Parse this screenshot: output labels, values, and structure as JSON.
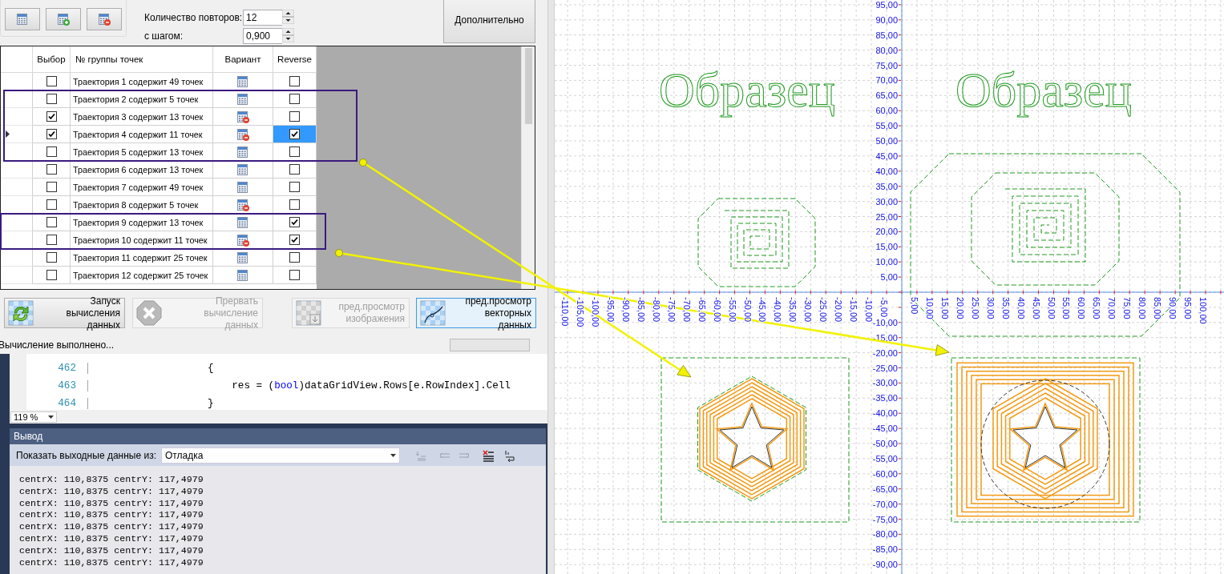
{
  "trajectory_group": {
    "buttons": [
      {
        "kind": "plain"
      },
      {
        "kind": "add"
      },
      {
        "kind": "remove"
      }
    ]
  },
  "params": [
    {
      "label": "Количество повторов:",
      "value": "12"
    },
    {
      "label": "с шагом:",
      "value": "0,900"
    }
  ],
  "more_button": "Дополнительно",
  "grid": {
    "columns": [
      "Выбор",
      "№ группы точек",
      "Вариант",
      "Reverse"
    ],
    "rows": [
      {
        "current": false,
        "choice": false,
        "name": "Траектория 1 содержит 49 точек",
        "kind": "plain",
        "reverse": false,
        "reverse_selected": false
      },
      {
        "current": false,
        "choice": false,
        "name": "Траектория 2 содержит 5 точек",
        "kind": "plain",
        "reverse": false,
        "reverse_selected": false
      },
      {
        "current": false,
        "choice": true,
        "name": "Траектория 3 содержит 13 точек",
        "kind": "remove",
        "reverse": false,
        "reverse_selected": false
      },
      {
        "current": true,
        "choice": true,
        "name": "Траектория 4 содержит 11 точек",
        "kind": "remove",
        "reverse": true,
        "reverse_selected": true
      },
      {
        "current": false,
        "choice": false,
        "name": "Траектория 5 содержит 13 точек",
        "kind": "plain",
        "reverse": false,
        "reverse_selected": false
      },
      {
        "current": false,
        "choice": false,
        "name": "Траектория 6 содержит 13 точек",
        "kind": "plain",
        "reverse": false,
        "reverse_selected": false
      },
      {
        "current": false,
        "choice": false,
        "name": "Траектория 7 содержит 49 точек",
        "kind": "plain",
        "reverse": false,
        "reverse_selected": false
      },
      {
        "current": false,
        "choice": false,
        "name": "Траектория 8 содержит 5 точек",
        "kind": "remove",
        "reverse": false,
        "reverse_selected": false
      },
      {
        "current": false,
        "choice": false,
        "name": "Траектория 9 содержит 13 точек",
        "kind": "plain",
        "reverse": true,
        "reverse_selected": false
      },
      {
        "current": false,
        "choice": false,
        "name": "Траектория 10 содержит 11 точек",
        "kind": "remove",
        "reverse": true,
        "reverse_selected": false
      },
      {
        "current": false,
        "choice": false,
        "name": "Траектория 11 содержит 25 точек",
        "kind": "plain",
        "reverse": false,
        "reverse_selected": false
      },
      {
        "current": false,
        "choice": false,
        "name": "Траектория 12 содержит 25 точек",
        "kind": "plain",
        "reverse": false,
        "reverse_selected": false
      }
    ]
  },
  "actions": [
    {
      "kind": "run",
      "label": "Запуск вычисления данных",
      "disabled": false,
      "selected": false
    },
    {
      "kind": "stop",
      "label": "Прервать вычисление данных",
      "disabled": true,
      "selected": false
    },
    {
      "kind": "image",
      "label": "пред.просмотр изображения",
      "disabled": true,
      "selected": false
    },
    {
      "kind": "vector",
      "label": "пред.просмотр векторных данных",
      "disabled": false,
      "selected": true
    }
  ],
  "status": {
    "text": "Вычисление выполнено...",
    "level": 0
  },
  "editor": {
    "lines": [
      {
        "number": "462",
        "tokens": [
          {
            "kind": "plain",
            "text": "                  {"
          }
        ]
      },
      {
        "number": "463",
        "tokens": [
          {
            "kind": "plain",
            "text": "                      res = ("
          },
          {
            "kind": "keyword",
            "text": "bool"
          },
          {
            "kind": "plain",
            "text": ")dataGridView.Rows[e.RowIndex].Cell"
          }
        ]
      },
      {
        "number": "464",
        "tokens": [
          {
            "kind": "plain",
            "text": "                  }"
          }
        ]
      }
    ],
    "zoom": "119 %"
  },
  "output": {
    "title": "Вывод",
    "source_label": "Показать выходные данные из:",
    "source": "Отладка",
    "lines": [
      "centrX: 110,8375 centrY: 117,4979",
      "centrX: 110,8375 centrY: 117,4979",
      "centrX: 110,8375 centrY: 117,4979",
      "centrX: 110,8375 centrY: 117,4979",
      "centrX: 110,8375 centrY: 117,4979",
      "centrX: 110,8375 centrY: 117,4979",
      "centrX: 110,8375 centrY: 117,4979",
      "centrX: 110,8375 centrY: 117,4979"
    ]
  },
  "canvas": {
    "sample_labels": [
      "Образец",
      "Образец"
    ],
    "x_negative_labels": [
      "-110,00",
      "-105,00",
      "-100,00",
      "-95,00",
      "-90,00",
      "-85,00",
      "-80,00",
      "-75,00",
      "-70,00",
      "-65,00",
      "-60,00",
      "-55,00",
      "-50,00",
      "-45,00",
      "-40,00",
      "-35,00",
      "-30,00",
      "-25,00",
      "-20,00",
      "-15,00",
      "-10,00",
      "-5,00"
    ],
    "x_positive_labels": [
      "5,00",
      "10,00",
      "15,00",
      "20,00",
      "25,00",
      "30,00",
      "35,00",
      "40,00",
      "45,00",
      "50,00",
      "55,00",
      "60,00",
      "65,00",
      "70,00",
      "75,00",
      "80,00",
      "85,00",
      "90,00",
      "95,00",
      "100,00"
    ],
    "y_upper_labels": [
      "95,00",
      "90,00",
      "85,00",
      "80,00",
      "75,00",
      "70,00",
      "65,00",
      "60,00",
      "55,00",
      "50,00",
      "45,00",
      "40,00",
      "35,00",
      "30,00",
      "25,00",
      "20,00",
      "15,00",
      "10,00",
      "5,00"
    ],
    "y_lower_labels": [
      "-10,00",
      "-15,00",
      "-20,00",
      "-25,00",
      "-30,00",
      "-35,00",
      "-40,00",
      "-45,00",
      "-50,00",
      "-55,00",
      "-60,00",
      "-65,00",
      "-70,00",
      "-75,00",
      "-80,00",
      "-85,00",
      "-90,00"
    ]
  }
}
